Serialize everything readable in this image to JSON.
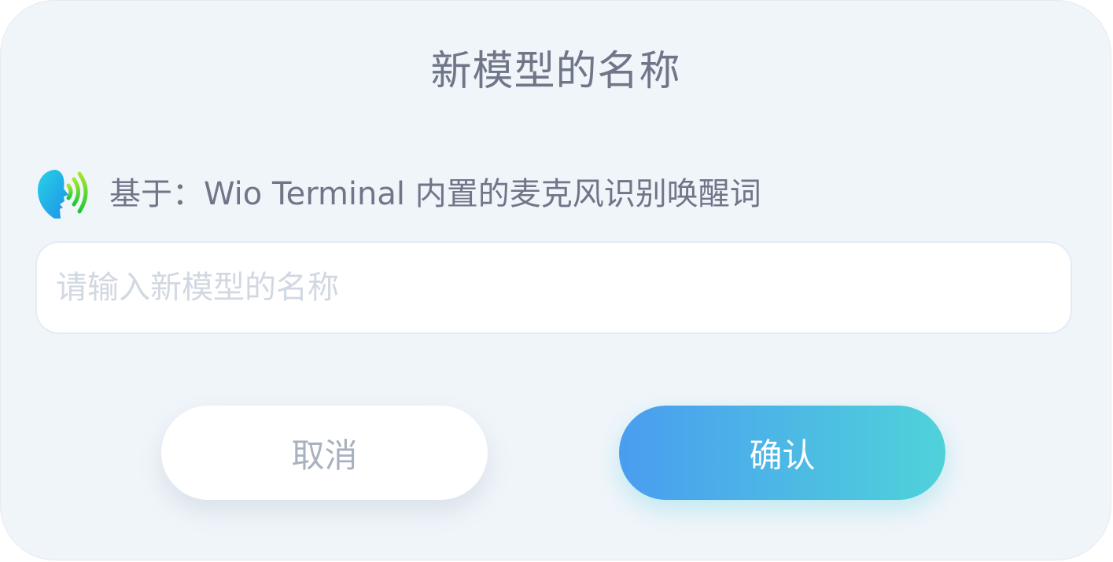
{
  "dialog": {
    "title": "新模型的名称",
    "based_on": "基于：Wio Terminal 内置的麦克风识别唤醒词",
    "based_on_icon": "voice-wake-icon",
    "name_input": {
      "value": "",
      "placeholder": "请输入新模型的名称"
    },
    "cancel_label": "取消",
    "confirm_label": "确认"
  },
  "colors": {
    "background": "#f0f5fa",
    "title_text": "#6f7688",
    "placeholder_text": "#d2d8e2",
    "confirm_gradient_start": "#4a9df0",
    "confirm_gradient_end": "#4fd2da",
    "cancel_text": "#a8b1bf"
  }
}
